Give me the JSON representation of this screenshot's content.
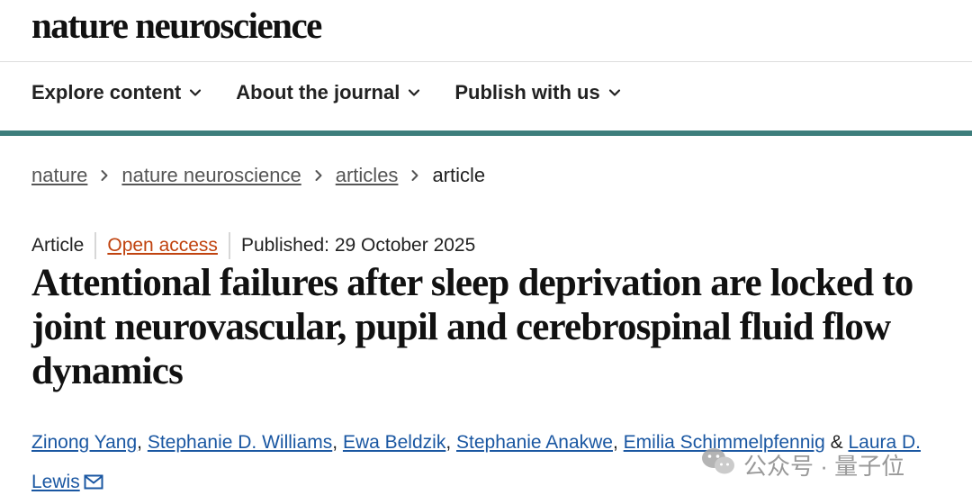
{
  "site": {
    "logo_text": "nature neuroscience"
  },
  "nav": {
    "items": [
      {
        "label": "Explore content"
      },
      {
        "label": "About the journal"
      },
      {
        "label": "Publish with us"
      }
    ]
  },
  "breadcrumb": {
    "items": [
      "nature",
      "nature neuroscience",
      "articles"
    ],
    "current": "article"
  },
  "article": {
    "type": "Article",
    "access": "Open access",
    "published": "Published: 29 October 2025",
    "title": "Attentional failures after sleep deprivation are locked to joint neurovascular, pupil and cerebrospinal fluid flow dynamics",
    "authors": [
      "Zinong Yang",
      "Stephanie D. Williams",
      "Ewa Beldzik",
      "Stephanie Anakwe",
      "Emilia Schimmelpfennig",
      "Laura D. Lewis"
    ],
    "author_separators": [
      ",",
      ",",
      ",",
      ",",
      "&"
    ]
  },
  "watermark": {
    "text": "公众号 · 量子位"
  },
  "colors": {
    "teal_bar": "#3d7e7c",
    "open_access": "#c0430f",
    "author_link": "#1a57a2"
  }
}
